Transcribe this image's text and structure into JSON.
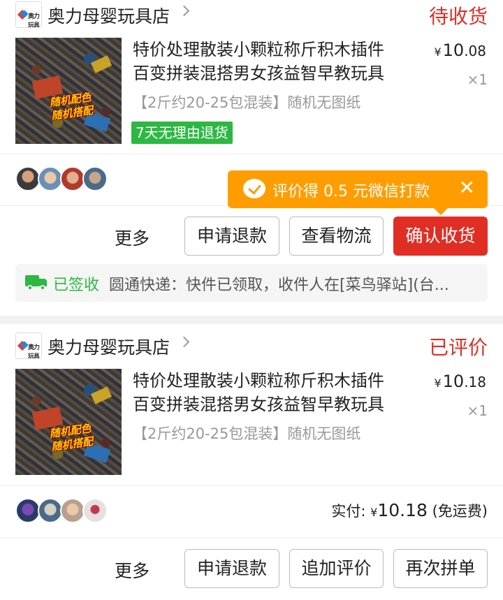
{
  "orders": [
    {
      "shop_name": "奥力母婴玩具店",
      "shop_logo_text": "奥力玩具",
      "status": "待收货",
      "status_color": "#e02e24",
      "product_title_line1": "特价处理散装小颗粒称斤积木插件",
      "product_title_line2": "百变拼装混搭男女孩益智早教玩具",
      "image_overlay_line1": "随机配色",
      "image_overlay_line2": "随机搭配",
      "price_symbol": "¥",
      "price_int": "10",
      "price_dec": ".08",
      "quantity": "×1",
      "spec": "【2斤约20-25包混装】随机无图纸",
      "badge": "7天无理由退货",
      "badge_color": "#2db843",
      "tooltip": {
        "text": "评价得 0.5 元微信打款",
        "close": "✕",
        "icon": "wechat-icon",
        "bg_color": "#ff9d00"
      },
      "buttons": {
        "more": "更多",
        "refund": "申请退款",
        "logistics": "查看物流",
        "confirm": "确认收货"
      },
      "shipping": {
        "status": "已签收",
        "text": "圆通快递：快件已领取，收件人在[菜鸟驿站](台..."
      }
    },
    {
      "shop_name": "奥力母婴玩具店",
      "shop_logo_text": "奥力玩具",
      "status": "已评价",
      "status_color": "#e02e24",
      "product_title_line1": "特价处理散装小颗粒称斤积木插件",
      "product_title_line2": "百变拼装混搭男女孩益智早教玩具",
      "image_overlay_line1": "随机配色",
      "image_overlay_line2": "随机搭配",
      "price_symbol": "¥",
      "price_int": "10",
      "price_dec": ".18",
      "quantity": "×1",
      "spec": "【2斤约20-25包混装】随机无图纸",
      "paid_label": "实付:",
      "paid_symbol": "¥",
      "paid_amount": "10.18",
      "paid_note": "(免运费)",
      "buttons": {
        "more": "更多",
        "refund": "申请退款",
        "review": "追加评价",
        "reorder": "再次拼单"
      }
    }
  ]
}
